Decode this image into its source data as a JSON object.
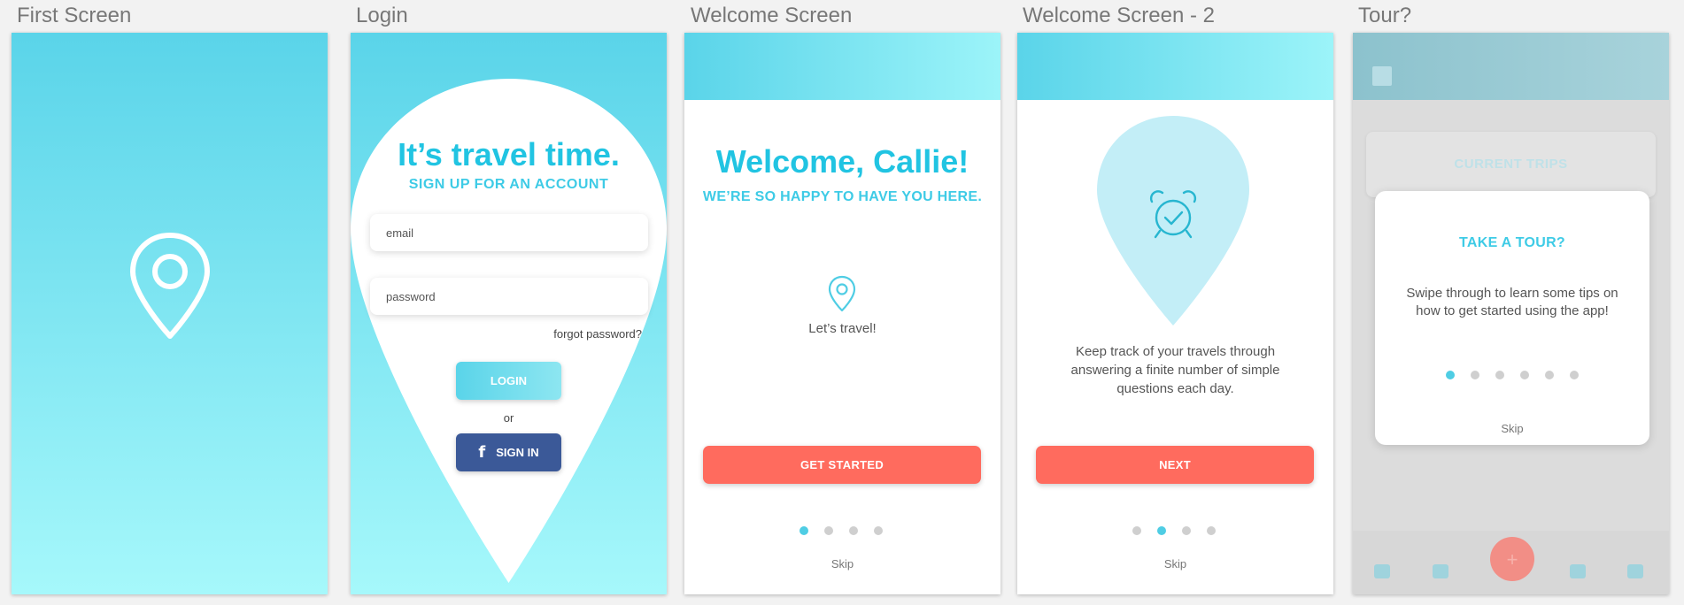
{
  "artboards": {
    "first": {
      "title": "First Screen"
    },
    "login": {
      "title": "Login",
      "headline": "It’s travel time.",
      "subheading": "SIGN UP FOR AN ACCOUNT",
      "email_placeholder": "email",
      "password_placeholder": "password",
      "forgot": "forgot password?",
      "login_button": "LOGIN",
      "or": "or",
      "facebook_button": "SIGN IN"
    },
    "welcome": {
      "title": "Welcome Screen",
      "headline": "Welcome, Callie!",
      "subheading": "WE’RE SO HAPPY TO HAVE YOU HERE.",
      "caption": "Let’s travel!",
      "button": "GET STARTED",
      "skip": "Skip",
      "dots": 4,
      "active_dot": 0
    },
    "welcome2": {
      "title": "Welcome Screen - 2",
      "body": "Keep track of your travels through answering a finite number of simple questions each day.",
      "button": "NEXT",
      "skip": "Skip",
      "dots": 4,
      "active_dot": 1
    },
    "tour": {
      "title": "Tour?",
      "current_trips": "CURRENT TRIPS",
      "modal_title": "TAKE A TOUR?",
      "modal_body": "Swipe through to learn some tips on how to get started using the app!",
      "skip": "Skip",
      "dots": 6,
      "active_dot": 0
    }
  },
  "colors": {
    "accent": "#21c4e2",
    "coral": "#ff6b5e",
    "facebook": "#3b5998",
    "dot_inactive": "#cfcfcf",
    "dot_active": "#4fcde4"
  },
  "icons": [
    "location-pin-icon",
    "facebook-icon",
    "alarm-clock-icon",
    "menu-icon",
    "home-icon",
    "suitcase-icon",
    "plus-icon",
    "user-icon",
    "bell-icon"
  ]
}
